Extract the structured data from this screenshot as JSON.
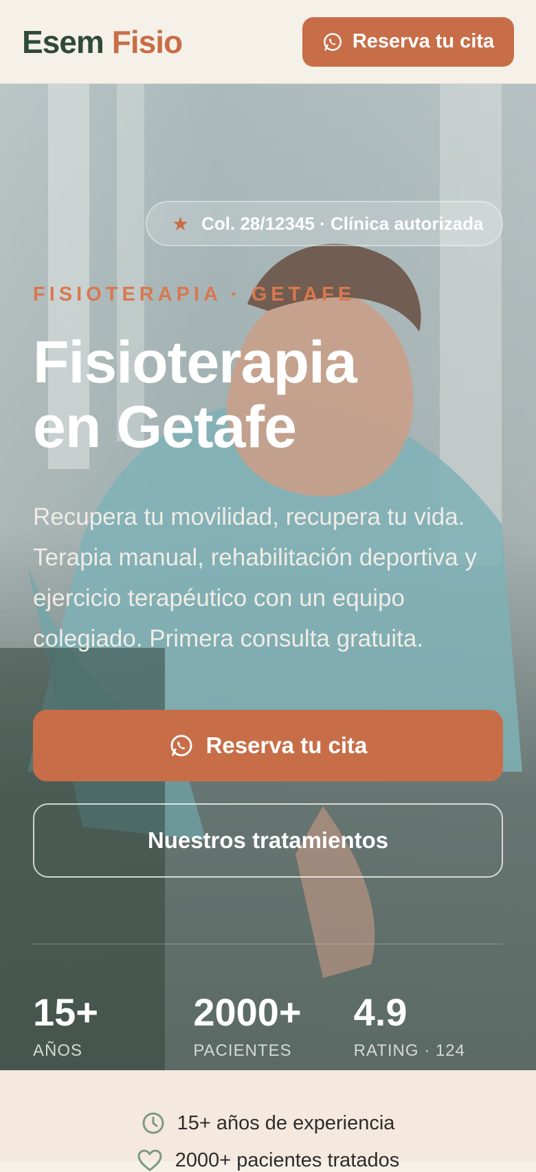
{
  "header": {
    "logo_part1": "Esem",
    "logo_part2": "Fisio",
    "cta_label": "Reserva tu cita"
  },
  "hero": {
    "badge_text": "Col. 28/12345 · Clínica autorizada",
    "eyebrow": "FISIOTERAPIA · GETAFE",
    "title_line1": "Fisioterapia",
    "title_line2": "en Getafe",
    "description": "Recupera tu movilidad, recupera tu vida. Terapia manual, rehabilitación deportiva y ejercicio terapéutico con un equipo colegiado. Primera consulta gratuita.",
    "primary_cta": "Reserva tu cita",
    "secondary_cta": "Nuestros tratamientos"
  },
  "stats": [
    {
      "value": "15+",
      "label": "AÑOS"
    },
    {
      "value": "2000+",
      "label": "PACIENTES"
    },
    {
      "value": "4.9",
      "label": "RATING · 124"
    }
  ],
  "highlights": [
    {
      "icon": "clock-icon",
      "text": "15+ años de experiencia"
    },
    {
      "icon": "heart-icon",
      "text": "2000+ pacientes tratados"
    }
  ],
  "colors": {
    "accent": "#c76e48",
    "brand_dark": "#2f4a3a",
    "background": "#f6f1e8"
  }
}
